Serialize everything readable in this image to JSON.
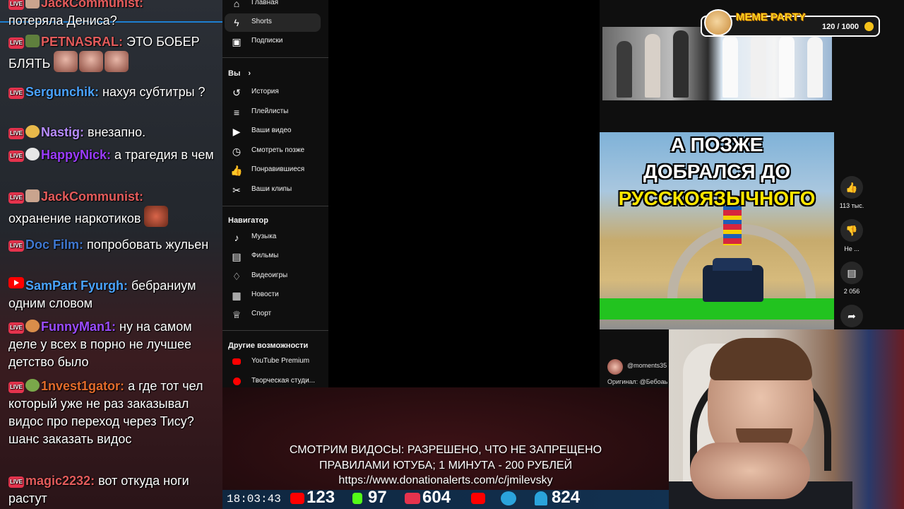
{
  "chat": {
    "messages": [
      {
        "badge": "live",
        "nick": "JackCommunist:",
        "nick_color": "#e35b5b",
        "text": "потеряла Дениса?"
      },
      {
        "badge": "live",
        "nick": "PETNASRAL:",
        "nick_color": "#e35b5b",
        "text": "ЭТО БОБЕР БЛЯТЬ"
      },
      {
        "badge": "live",
        "nick": "Sergunchik:",
        "nick_color": "#4aa3ff",
        "text": "нахуя субтитры ?"
      },
      {
        "badge": "live",
        "nick": "Nastig:",
        "nick_color": "#b78cff",
        "text": "внезапно."
      },
      {
        "badge": "live",
        "nick": "HappyNick:",
        "nick_color": "#9b3cff",
        "text": "а трагедия в чем"
      },
      {
        "badge": "live",
        "nick": "JackCommunist:",
        "nick_color": "#e35b5b",
        "text": "охранение наркотиков"
      },
      {
        "badge": "live",
        "nick": "Doc Film:",
        "nick_color": "#3f78d1",
        "text": "попробовать жульен"
      },
      {
        "badge": "youtube",
        "nick": "SamPart Fyurgh:",
        "nick_color": "#4aa3ff",
        "text": "бебраниум одним словом"
      },
      {
        "badge": "live",
        "nick": "FunnyMan1:",
        "nick_color": "#9b4cff",
        "text": "ну на самом деле у всех в порно не лучшее детство было"
      },
      {
        "badge": "live",
        "nick": "1nvest1gator:",
        "nick_color": "#e36b2b",
        "text": "а где тот чел который уже не раз заказывал видос про переход через Тису? шанс заказать видос"
      },
      {
        "badge": "live",
        "nick": "magic2232:",
        "nick_color": "#e35b5b",
        "text": "вот откуда ноги растут"
      }
    ]
  },
  "sidebar": {
    "top_items": [
      {
        "label": "Главная",
        "icon": "home-icon",
        "glyph": "⌂"
      },
      {
        "label": "Shorts",
        "icon": "shorts-icon",
        "glyph": "ϟ",
        "active": true
      },
      {
        "label": "Подписки",
        "icon": "subscriptions-icon",
        "glyph": "▣"
      }
    ],
    "you_heading": "Вы",
    "you_items": [
      {
        "label": "История",
        "icon": "history-icon",
        "glyph": "↺"
      },
      {
        "label": "Плейлисты",
        "icon": "playlists-icon",
        "glyph": "≡"
      },
      {
        "label": "Ваши видео",
        "icon": "your-videos-icon",
        "glyph": "▶"
      },
      {
        "label": "Смотреть позже",
        "icon": "watch-later-icon",
        "glyph": "◷"
      },
      {
        "label": "Понравившиеся",
        "icon": "liked-icon",
        "glyph": "👍"
      },
      {
        "label": "Ваши клипы",
        "icon": "clips-icon",
        "glyph": "✂"
      }
    ],
    "nav_heading": "Навигатор",
    "nav_items": [
      {
        "label": "Музыка",
        "icon": "music-icon",
        "glyph": "♪"
      },
      {
        "label": "Фильмы",
        "icon": "films-icon",
        "glyph": "▤"
      },
      {
        "label": "Видеоигры",
        "icon": "gaming-icon",
        "glyph": "♢"
      },
      {
        "label": "Новости",
        "icon": "news-icon",
        "glyph": "▦"
      },
      {
        "label": "Спорт",
        "icon": "sport-icon",
        "glyph": "♕"
      }
    ],
    "more_heading": "Другие возможности",
    "more_items": [
      {
        "label": "YouTube Premium",
        "icon": "youtube-premium-icon"
      },
      {
        "label": "Творческая студи...",
        "icon": "creative-studio-icon"
      }
    ]
  },
  "shorts": {
    "video_title_lines": [
      "А ПОЗЖЕ",
      "ДОБРАЛСЯ ДО",
      "РУССКОЯЗЫЧНОГО"
    ],
    "channel": "@moments35",
    "original": "Оригинал: @Бебоаь",
    "likes": "113 тыс.",
    "dislike_label": "Не ...",
    "comments": "2 056"
  },
  "meme_party": {
    "title": "MEME PARTY",
    "progress_text": "120 / 1000",
    "progress": 0.12
  },
  "banner": {
    "line1": "СМОТРИМ ВИДОСЫ: РАЗРЕШЕНО, ЧТО НЕ ЗАПРЕЩЕНО",
    "line2": "ПРАВИЛАМИ ЮТУБА; 1 МИНУТА - 200 РУБЛЕЙ",
    "line3": "https://www.donationalerts.com/c/jmilevsky"
  },
  "status": {
    "clock": "18:03:43",
    "youtube_viewers": "123",
    "kick_viewers": "97",
    "vk_live_viewers": "604",
    "telegram_members": "824"
  },
  "colors": {
    "youtube_red": "#ff0000",
    "kick_green": "#53fc18",
    "vk_live": "#e5334d",
    "telegram": "#2aa3dc",
    "meme_gold": "#ffd21f"
  }
}
